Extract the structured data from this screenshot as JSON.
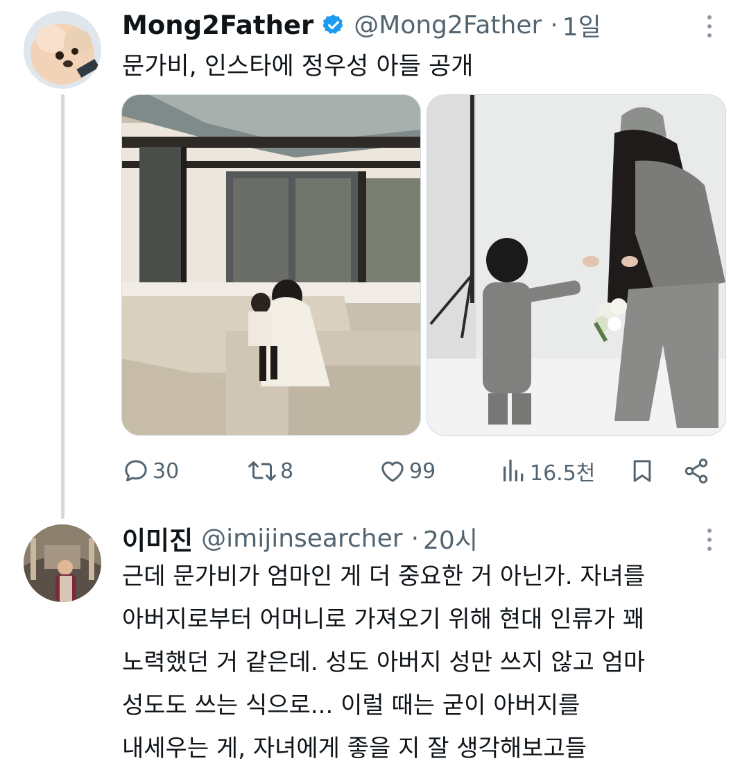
{
  "tweet1": {
    "display_name": "Mong2Father",
    "handle": "@Mong2Father",
    "separator": "·",
    "time": "1일",
    "text": "문가비, 인스타에 정우성 아들 공개",
    "verified_color": "#1d9bf0",
    "avatar_icon": "pomeranian-dog-avatar",
    "media": [
      "hanok-courtyard-photo",
      "studio-flowers-photo"
    ],
    "actions": {
      "reply_count": "30",
      "retweet_count": "8",
      "like_count": "99",
      "view_count": "16.5천"
    }
  },
  "tweet2": {
    "display_name": "이미진",
    "handle": "@imijinsearcher",
    "separator": "·",
    "time": "20시",
    "avatar_icon": "person-in-arcade-avatar",
    "lines": [
      "근데 문가비가 엄마인 게 더 중요한 거 아닌가. 자녀를",
      "아버지로부터 어머니로 가져오기 위해 현대 인류가 꽤",
      "노력했던 거 같은데. 성도 아버지 성만 쓰지 않고 엄마",
      "성도도 쓰는 식으로... 이럴 때는 굳이 아버지를",
      "내세우는 게, 자녀에게 좋을 지 잘 생각해보고들"
    ]
  },
  "colors": {
    "text": "#0f1419",
    "secondary": "#536471",
    "thread_line": "#cfd9de",
    "accent": "#1d9bf0"
  }
}
